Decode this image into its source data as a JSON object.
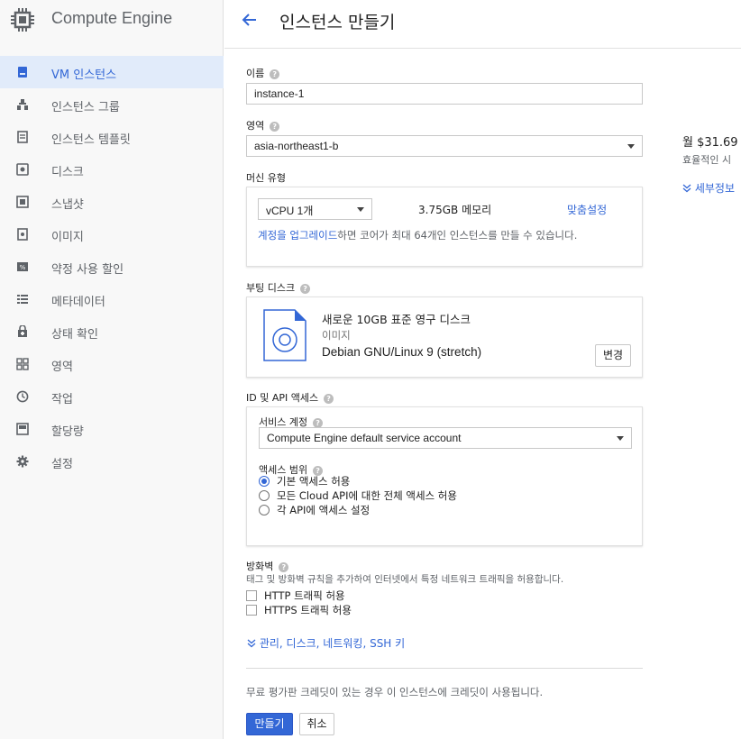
{
  "product": {
    "name": "Compute Engine",
    "icon": "chip-icon"
  },
  "nav": [
    {
      "label": "VM 인스턴스",
      "icon": "vm-instances-icon",
      "active": true
    },
    {
      "label": "인스턴스 그룹",
      "icon": "instance-groups-icon"
    },
    {
      "label": "인스턴스 템플릿",
      "icon": "instance-templates-icon"
    },
    {
      "label": "디스크",
      "icon": "disk-icon"
    },
    {
      "label": "스냅샷",
      "icon": "snapshot-icon"
    },
    {
      "label": "이미지",
      "icon": "image-icon"
    },
    {
      "label": "약정 사용 할인",
      "icon": "percent-icon"
    },
    {
      "label": "메타데이터",
      "icon": "metadata-icon"
    },
    {
      "label": "상태 확인",
      "icon": "health-check-icon"
    },
    {
      "label": "영역",
      "icon": "zones-icon"
    },
    {
      "label": "작업",
      "icon": "operations-icon"
    },
    {
      "label": "할당량",
      "icon": "quotas-icon"
    },
    {
      "label": "설정",
      "icon": "settings-icon"
    }
  ],
  "header": {
    "title": "인스턴스 만들기",
    "back_icon": "back-arrow-icon"
  },
  "form": {
    "name_label": "이름",
    "name_value": "instance-1",
    "zone_label": "영역",
    "zone_value": "asia-northeast1-b",
    "machine_type_label": "머신 유형",
    "vcpu_value": "vCPU 1개",
    "memory_text": "3.75GB 메모리",
    "customize_link": "맞춤설정",
    "upgrade_link": "계정을 업그레이드",
    "upgrade_rest": "하면 코어가 최대 64개인 인스턴스를 만들 수 있습니다.",
    "boot_disk_label": "부팅 디스크",
    "boot_disk_title": "새로운 10GB 표준 영구 디스크",
    "boot_disk_sub": "이미지",
    "boot_disk_image": "Debian GNU/Linux 9 (stretch)",
    "boot_disk_change": "변경",
    "identity_label": "ID 및 API 액세스",
    "service_account_label": "서비스 계정",
    "service_account_value": "Compute Engine default service account",
    "access_scope_label": "액세스 범위",
    "access_options": [
      "기본 액세스 허용",
      "모든 Cloud API에 대한 전체 액세스 허용",
      "각 API에 액세스 설정"
    ],
    "firewall_label": "방화벽",
    "firewall_desc": "태그 및 방화벽 규칙을 추가하여 인터넷에서 특정 네트워크 트래픽을 허용합니다.",
    "firewall_http": "HTTP 트래픽 허용",
    "firewall_https": "HTTPS 트래픽 허용",
    "more_link": "관리, 디스크, 네트워킹, SSH 키",
    "credit_note": "무료 평가판 크레딧이 있는 경우 이 인스턴스에 크레딧이 사용됩니다.",
    "create_button": "만들기",
    "cancel_button": "취소"
  },
  "pricing": {
    "monthly": "월 $31.69",
    "hourly_partial": "효율적인 시",
    "details_link": "세부정보"
  },
  "colors": {
    "accent": "#3367d6",
    "active_bg": "#e1ebfa",
    "sidebar_bg": "#f8f8f8"
  }
}
